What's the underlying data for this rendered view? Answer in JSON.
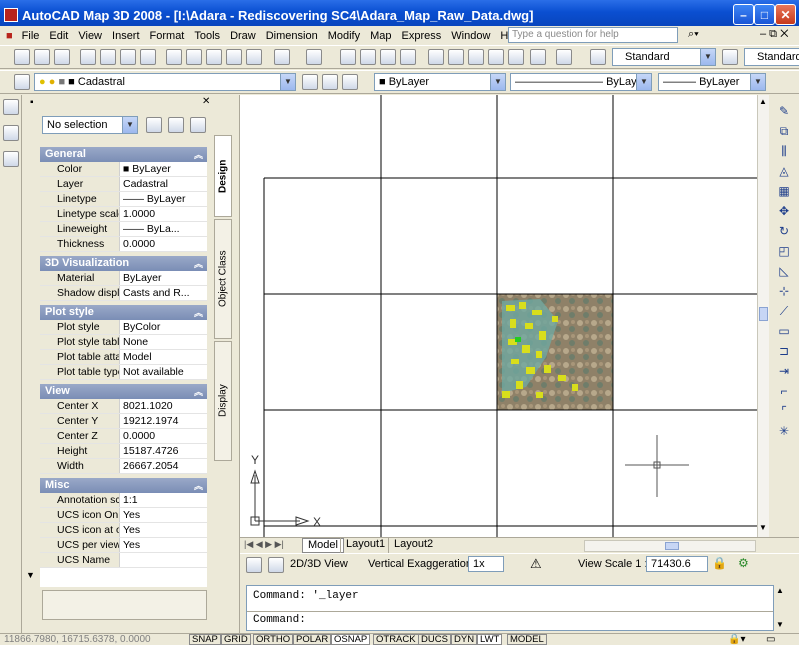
{
  "window": {
    "title": "AutoCAD Map 3D 2008 - [I:\\Adara - Rediscovering SC4\\Adara_Map_Raw_Data.dwg]"
  },
  "menu": [
    "File",
    "Edit",
    "View",
    "Insert",
    "Format",
    "Tools",
    "Draw",
    "Dimension",
    "Modify",
    "Map",
    "Express",
    "Window",
    "Help"
  ],
  "question_placeholder": "Type a question for help",
  "toolbar": {
    "text_style": "Standard",
    "dim_style": "Standard"
  },
  "layer_toolbar": {
    "layer": "Cadastral",
    "color": "ByLayer",
    "linetype": "ByLayer",
    "lineweight": "ByLayer"
  },
  "properties": {
    "selection": "No selection",
    "tabs": [
      "Design",
      "Object Class",
      "Display"
    ],
    "sections": [
      {
        "title": "General",
        "rows": [
          {
            "name": "Color",
            "value": "ByLayer"
          },
          {
            "name": "Layer",
            "value": "Cadastral"
          },
          {
            "name": "Linetype",
            "value": "—— ByLayer"
          },
          {
            "name": "Linetype scale",
            "value": "1.0000"
          },
          {
            "name": "Lineweight",
            "value": "—— ByLa..."
          },
          {
            "name": "Thickness",
            "value": "0.0000"
          }
        ]
      },
      {
        "title": "3D Visualization",
        "rows": [
          {
            "name": "Material",
            "value": "ByLayer"
          },
          {
            "name": "Shadow display",
            "value": "Casts and R..."
          }
        ]
      },
      {
        "title": "Plot style",
        "rows": [
          {
            "name": "Plot style",
            "value": "ByColor"
          },
          {
            "name": "Plot style table",
            "value": "None"
          },
          {
            "name": "Plot table attac...",
            "value": "Model"
          },
          {
            "name": "Plot table type",
            "value": "Not available"
          }
        ]
      },
      {
        "title": "View",
        "rows": [
          {
            "name": "Center X",
            "value": "8021.1020"
          },
          {
            "name": "Center Y",
            "value": "19212.1974"
          },
          {
            "name": "Center Z",
            "value": "0.0000"
          },
          {
            "name": "Height",
            "value": "15187.4726"
          },
          {
            "name": "Width",
            "value": "26667.2054"
          }
        ]
      },
      {
        "title": "Misc",
        "rows": [
          {
            "name": "Annotation scale",
            "value": "1:1"
          },
          {
            "name": "UCS icon On",
            "value": "Yes"
          },
          {
            "name": "UCS icon at origin",
            "value": "Yes"
          },
          {
            "name": "UCS per viewport",
            "value": "Yes"
          },
          {
            "name": "UCS Name",
            "value": ""
          }
        ]
      }
    ]
  },
  "canvas": {
    "ucs_x": "X",
    "ucs_y": "Y"
  },
  "layout_tabs": [
    "Model",
    "Layout1",
    "Layout2"
  ],
  "status_view": {
    "view_label": "2D/3D View",
    "exag_label": "Vertical Exaggeration:",
    "exag_value": "1x",
    "scale_label": "View Scale 1 :",
    "scale_value": "71430.6"
  },
  "command": {
    "line1": "Command: '_layer",
    "line2": "Command:"
  },
  "status_bar": {
    "coords": "11866.7980, 16715.6378, 0.0000",
    "buttons": [
      "SNAP",
      "GRID",
      "ORTHO",
      "POLAR",
      "OSNAP",
      "OTRACK",
      "DUCS",
      "DYN",
      "LWT",
      "MODEL"
    ]
  }
}
